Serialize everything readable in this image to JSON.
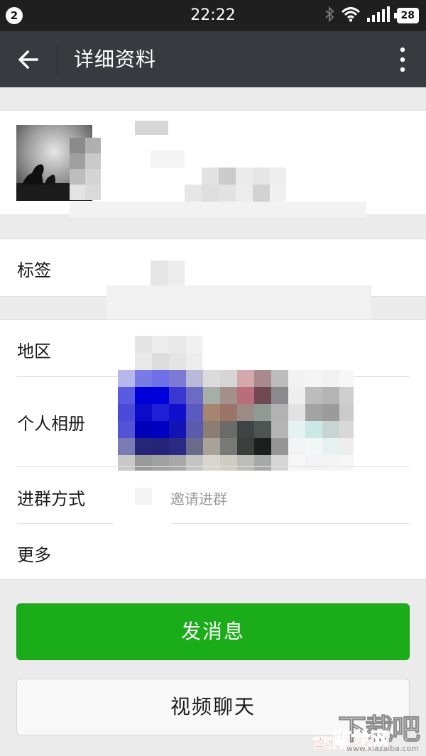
{
  "status_bar": {
    "notification_count": "2",
    "time": "22:22",
    "battery": "28",
    "icons": [
      "bluetooth-icon",
      "wifi-icon",
      "signal-icon",
      "battery-icon"
    ]
  },
  "nav": {
    "title": "详细资料",
    "back_icon": "arrow-left-icon",
    "more_icon": "more-vertical-icon"
  },
  "rows": {
    "tags": "标签",
    "region": "地区",
    "album": "个人相册",
    "join_method": "进群方式",
    "join_method_value": "邀请进群",
    "more": "更多"
  },
  "buttons": {
    "send_message": "发消息",
    "video_chat": "视频聊天"
  },
  "watermark": {
    "big": "下载吧",
    "red": "云南龙网",
    "url": "www.xiazaiba.com"
  },
  "colors": {
    "status_bar": "#1f1f1f",
    "nav_bar": "#393a3f",
    "primary_green": "#1aad19",
    "page_bg": "#ebebeb"
  }
}
